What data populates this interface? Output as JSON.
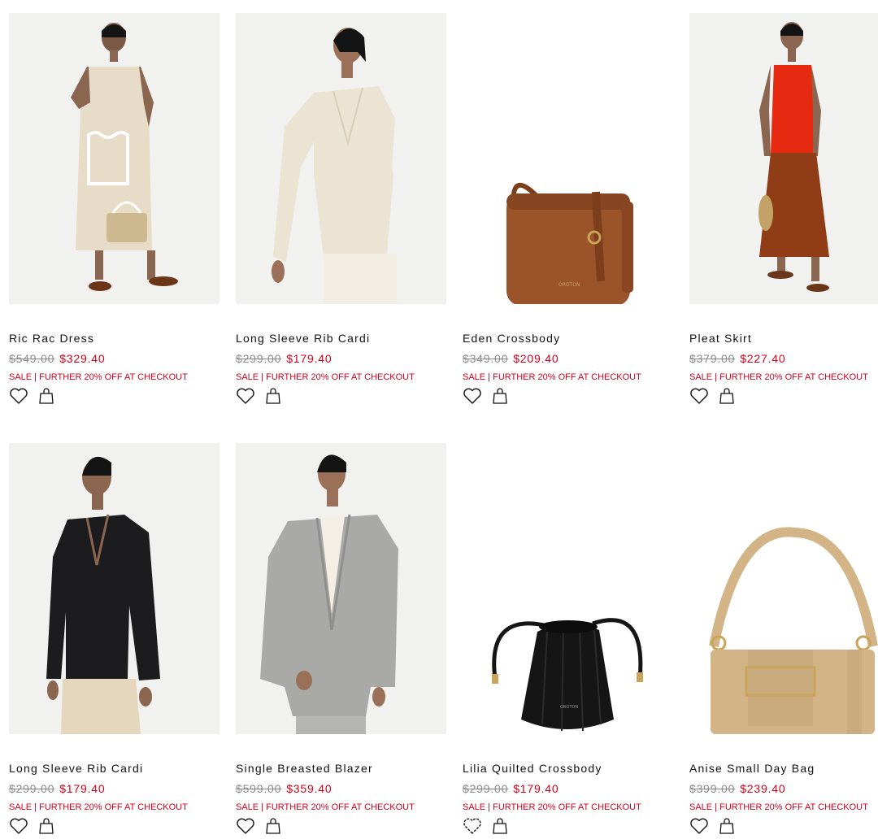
{
  "products": [
    {
      "name": "Ric Rac Dress",
      "was": "$549.00",
      "now": "$329.40",
      "promo": "SALE | FURTHER 20% OFF AT CHECKOUT",
      "image": "model wearing cream ric rac dress",
      "color": "#e7dcc7"
    },
    {
      "name": "Long Sleeve Rib Cardi",
      "was": "$299.00",
      "now": "$179.40",
      "promo": "SALE | FURTHER 20% OFF AT CHECKOUT",
      "image": "model wearing cream rib cardigan",
      "color": "#ece4d2"
    },
    {
      "name": "Eden Crossbody",
      "was": "$349.00",
      "now": "$209.40",
      "promo": "SALE | FURTHER 20% OFF AT CHECKOUT",
      "image": "tan leather crossbody bag",
      "color": "#9b532a"
    },
    {
      "name": "Pleat Skirt",
      "was": "$379.00",
      "now": "$227.40",
      "promo": "SALE | FURTHER 20% OFF AT CHECKOUT",
      "image": "model wearing red knit top and rust pleat skirt",
      "color": "#8f3c17"
    },
    {
      "name": "Long Sleeve Rib Cardi",
      "was": "$299.00",
      "now": "$179.40",
      "promo": "SALE | FURTHER 20% OFF AT CHECKOUT",
      "image": "model wearing black rib cardigan",
      "color": "#1c1c1e"
    },
    {
      "name": "Single Breasted Blazer",
      "was": "$599.00",
      "now": "$359.40",
      "promo": "SALE | FURTHER 20% OFF AT CHECKOUT",
      "image": "model wearing grey blazer",
      "color": "#a9a9a7"
    },
    {
      "name": "Lilia Quilted Crossbody",
      "was": "$299.00",
      "now": "$179.40",
      "promo": "SALE | FURTHER 20% OFF AT CHECKOUT",
      "image": "black quilted drawstring crossbody bag",
      "color": "#151515"
    },
    {
      "name": "Anise Small Day Bag",
      "was": "$399.00",
      "now": "$239.40",
      "promo": "SALE | FURTHER 20% OFF AT CHECKOUT",
      "image": "beige small day bag with buckle",
      "color": "#d2b487"
    }
  ],
  "icons": {
    "wishlist": "heart-icon",
    "bag": "shopping-bag-icon"
  },
  "colors": {
    "sale_red": "#d0021b",
    "strike_grey": "#8a8a8a"
  }
}
